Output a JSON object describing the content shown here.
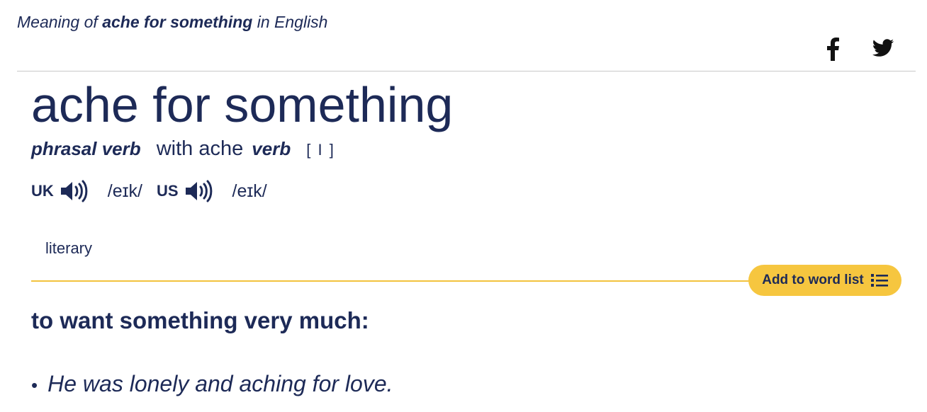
{
  "header": {
    "meaning_prefix": "Meaning of",
    "meaning_term": "ache for something",
    "meaning_suffix": "in English"
  },
  "share": {
    "facebook_icon": "facebook-icon",
    "twitter_icon": "twitter-icon"
  },
  "entry": {
    "headword": "ache for something",
    "pos": "phrasal verb",
    "with_text": "with ache",
    "verb_label": "verb",
    "grammar_code": "[ I ]",
    "pronunciations": [
      {
        "region": "UK",
        "ipa": "/eɪk/"
      },
      {
        "region": "US",
        "ipa": "/eɪk/"
      }
    ],
    "usage_label": "literary",
    "add_to_word_list": "Add to word list",
    "definition": "to want something very much:",
    "example_bullet": "•",
    "example": "He was lonely and aching for love."
  },
  "colors": {
    "text": "#1d2a57",
    "accent": "#f6c63f",
    "rule": "#c9c9c9"
  }
}
